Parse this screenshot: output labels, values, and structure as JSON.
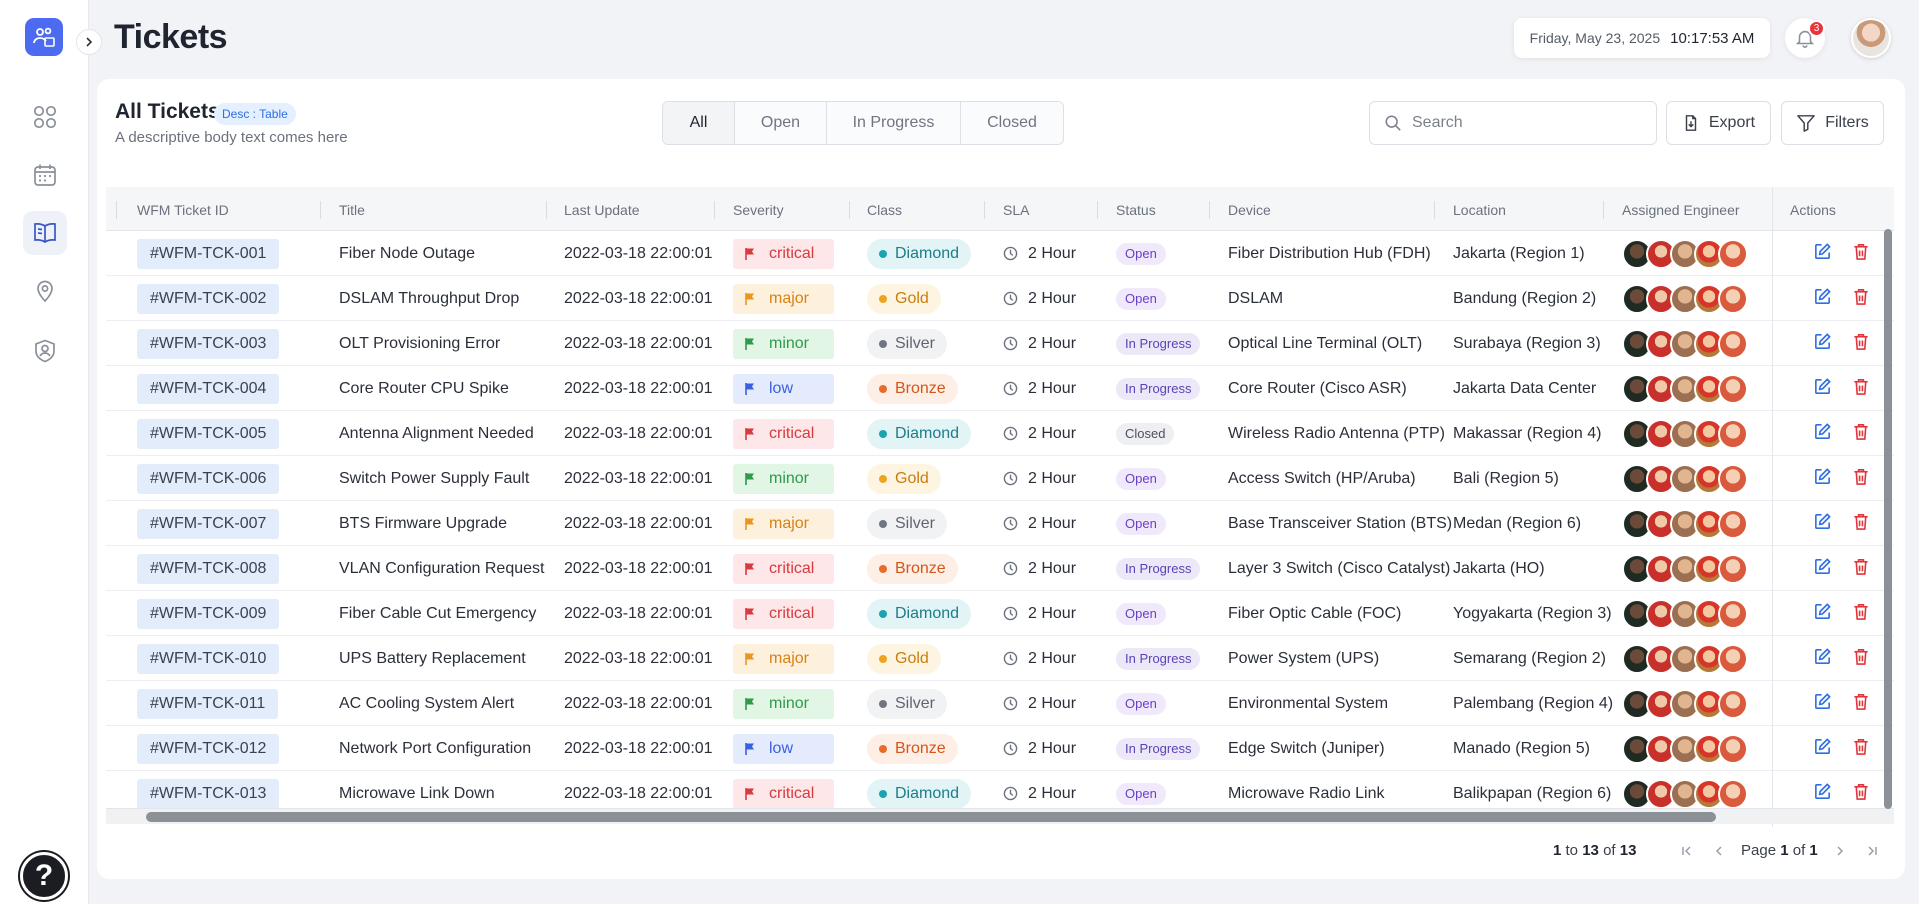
{
  "header": {
    "title": "Tickets",
    "date": "Friday, May 23, 2025",
    "time": "10:17:53 AM",
    "notification_count": "3"
  },
  "sidebar": {
    "items": [
      {
        "name": "dashboard-grid-icon"
      },
      {
        "name": "calendar-icon"
      },
      {
        "name": "book-open-icon"
      },
      {
        "name": "location-pin-icon"
      },
      {
        "name": "user-shield-icon"
      }
    ],
    "help_label": "?"
  },
  "card": {
    "title": "All Tickets",
    "badge": "Desc : Table",
    "subtitle": "A descriptive body text comes here",
    "tabs": [
      "All",
      "Open",
      "In Progress",
      "Closed"
    ],
    "active_tab": "All",
    "search_placeholder": "Search",
    "export_label": "Export",
    "filters_label": "Filters"
  },
  "table": {
    "columns": [
      "WFM Ticket ID",
      "Title",
      "Last Update",
      "Severity",
      "Class",
      "SLA",
      "Status",
      "Device",
      "Location",
      "Assigned Engineer",
      "Actions"
    ],
    "rows": [
      {
        "id": "#WFM-TCK-001",
        "title": "Fiber Node Outage",
        "updated": "2022-03-18 22:00:01",
        "severity": "critical",
        "class": "Diamond",
        "sla": "2 Hour",
        "status": "Open",
        "device": "Fiber Distribution Hub (FDH)",
        "location": "Jakarta (Region 1)"
      },
      {
        "id": "#WFM-TCK-002",
        "title": "DSLAM Throughput Drop",
        "updated": "2022-03-18 22:00:01",
        "severity": "major",
        "class": "Gold",
        "sla": "2 Hour",
        "status": "Open",
        "device": "DSLAM",
        "location": "Bandung (Region 2)"
      },
      {
        "id": "#WFM-TCK-003",
        "title": "OLT Provisioning Error",
        "updated": "2022-03-18 22:00:01",
        "severity": "minor",
        "class": "Silver",
        "sla": "2 Hour",
        "status": "In Progress",
        "device": "Optical Line Terminal (OLT)",
        "location": "Surabaya (Region 3)"
      },
      {
        "id": "#WFM-TCK-004",
        "title": "Core Router CPU Spike",
        "updated": "2022-03-18 22:00:01",
        "severity": "low",
        "class": "Bronze",
        "sla": "2 Hour",
        "status": "In Progress",
        "device": "Core Router (Cisco ASR)",
        "location": "Jakarta Data Center"
      },
      {
        "id": "#WFM-TCK-005",
        "title": "Antenna Alignment Needed",
        "updated": "2022-03-18 22:00:01",
        "severity": "critical",
        "class": "Diamond",
        "sla": "2 Hour",
        "status": "Closed",
        "device": "Wireless Radio Antenna (PTP)",
        "location": "Makassar (Region 4)"
      },
      {
        "id": "#WFM-TCK-006",
        "title": "Switch Power Supply Fault",
        "updated": "2022-03-18 22:00:01",
        "severity": "minor",
        "class": "Gold",
        "sla": "2 Hour",
        "status": "Open",
        "device": "Access Switch (HP/Aruba)",
        "location": "Bali (Region 5)"
      },
      {
        "id": "#WFM-TCK-007",
        "title": "BTS Firmware Upgrade",
        "updated": "2022-03-18 22:00:01",
        "severity": "major",
        "class": "Silver",
        "sla": "2 Hour",
        "status": "Open",
        "device": "Base Transceiver Station (BTS)",
        "location": "Medan (Region 6)"
      },
      {
        "id": "#WFM-TCK-008",
        "title": "VLAN Configuration Request",
        "updated": "2022-03-18 22:00:01",
        "severity": "critical",
        "class": "Bronze",
        "sla": "2 Hour",
        "status": "In Progress",
        "device": "Layer 3 Switch (Cisco Catalyst)",
        "location": "Jakarta (HO)"
      },
      {
        "id": "#WFM-TCK-009",
        "title": "Fiber Cable Cut Emergency",
        "updated": "2022-03-18 22:00:01",
        "severity": "critical",
        "class": "Diamond",
        "sla": "2 Hour",
        "status": "Open",
        "device": "Fiber Optic Cable (FOC)",
        "location": "Yogyakarta (Region 3)"
      },
      {
        "id": "#WFM-TCK-010",
        "title": "UPS Battery Replacement",
        "updated": "2022-03-18 22:00:01",
        "severity": "major",
        "class": "Gold",
        "sla": "2 Hour",
        "status": "In Progress",
        "device": "Power System (UPS)",
        "location": "Semarang (Region 2)"
      },
      {
        "id": "#WFM-TCK-011",
        "title": "AC Cooling System Alert",
        "updated": "2022-03-18 22:00:01",
        "severity": "minor",
        "class": "Silver",
        "sla": "2 Hour",
        "status": "Open",
        "device": "Environmental System",
        "location": "Palembang (Region 4)"
      },
      {
        "id": "#WFM-TCK-012",
        "title": "Network Port Configuration",
        "updated": "2022-03-18 22:00:01",
        "severity": "low",
        "class": "Bronze",
        "sla": "2 Hour",
        "status": "In Progress",
        "device": "Edge Switch (Juniper)",
        "location": "Manado (Region 5)"
      },
      {
        "id": "#WFM-TCK-013",
        "title": "Microwave Link Down",
        "updated": "2022-03-18 22:00:01",
        "severity": "critical",
        "class": "Diamond",
        "sla": "2 Hour",
        "status": "Open",
        "device": "Microwave Radio Link",
        "location": "Balikpapan (Region 6)"
      }
    ]
  },
  "pagination": {
    "range_start": "1",
    "range_end": "13",
    "total": "13",
    "page": "1",
    "page_total": "1",
    "to": "to",
    "of": "of",
    "page_label": "Page"
  },
  "colors": {
    "accent": "#4d6bf0",
    "critical": "#d83a3f",
    "edit": "#2f6fe0",
    "delete": "#e0353b"
  }
}
